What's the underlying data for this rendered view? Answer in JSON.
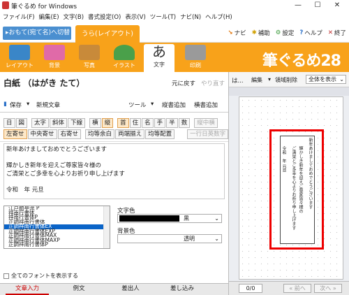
{
  "window": {
    "title": "筆ぐるめ for Windows",
    "min": "—",
    "max": "☐",
    "close": "✕"
  },
  "menu": [
    "ファイル(F)",
    "編集(E)",
    "文字(B)",
    "書式設定(O)",
    "表示(V)",
    "ツール(T)",
    "ナビ(N)",
    "ヘルプ(H)"
  ],
  "mode": {
    "switch_label": "▸おもて(宛て名)へ切替",
    "tab_label": "うら(レイアウト)"
  },
  "header_links": [
    {
      "icon": "arrow-icon",
      "label": "ナビ"
    },
    {
      "icon": "gear-icon",
      "label": "補助"
    },
    {
      "icon": "settings-icon",
      "label": "設定"
    },
    {
      "icon": "help-icon",
      "label": "ヘルプ"
    },
    {
      "icon": "close-icon",
      "label": "終了"
    }
  ],
  "toolbar": [
    {
      "label": "レイアウト",
      "color": "#3a86c8"
    },
    {
      "label": "背景",
      "color": "#e06aa8"
    },
    {
      "label": "写真",
      "color": "#c88a3a"
    },
    {
      "label": "イラスト",
      "color": "#4aa04a"
    },
    {
      "label": "文字",
      "color": "#222222"
    },
    {
      "label": "印刷",
      "color": "#808080"
    }
  ],
  "brand": "筆ぐるめ28",
  "editor": {
    "title": "白紙 （はがき たて）",
    "undo": "元に戻す",
    "redo": "やり直す",
    "save": "保存",
    "new_text": "新規文章",
    "tools": "ツール",
    "add_vertical": "縦書追加",
    "add_horizontal": "横書追加"
  },
  "format_row1": [
    "日",
    "図",
    "太字",
    "斜体",
    "下線",
    "横",
    "縦",
    "首",
    "住",
    "名",
    "手",
    "半",
    "数",
    "縦中横"
  ],
  "format_row2": [
    "左寄せ",
    "中央寄せ",
    "右寄せ",
    "均等余白",
    "両端揃え",
    "均等配置",
    "一行日英数字"
  ],
  "text_content": "新年あけましておめでとうございます\n\n輝かしき新年を迎えご尊家皆々様の\nご清栄とご多幸を心よりお祈り申し上げます\n\n令和　年 元旦",
  "fonts": [
    "江戸勘亭流 P",
    "祥南行書体",
    "祥南行書体P",
    "正調祥南行書体",
    "正調祥南行書体EX",
    "正調祥南行書体EXP",
    "正調祥南行書体MAX",
    "正調祥南行書体MAXP",
    "正調祥南行書体P"
  ],
  "selected_font_index": 4,
  "text_color": {
    "label": "文字色",
    "value": "黒"
  },
  "bg_color": {
    "label": "背景色",
    "value": "透明"
  },
  "show_all_fonts": "全てのフォントを表示する",
  "bottom_tabs": [
    "文章入力",
    "例文",
    "差出人",
    "差し込み"
  ],
  "preview": {
    "label": "は...",
    "edit": "編集",
    "delete_area": "領域削除",
    "view_select": "全体を表示",
    "page": "0/0",
    "prev": "前へ",
    "next": "次へ"
  },
  "card_lines": [
    "新年あけましておめでとうございます",
    "輝かしき新年を迎えご尊家皆々様の",
    "ご清栄とご多幸を心よりお祈り申し上げます",
    "令和　年 元旦"
  ]
}
